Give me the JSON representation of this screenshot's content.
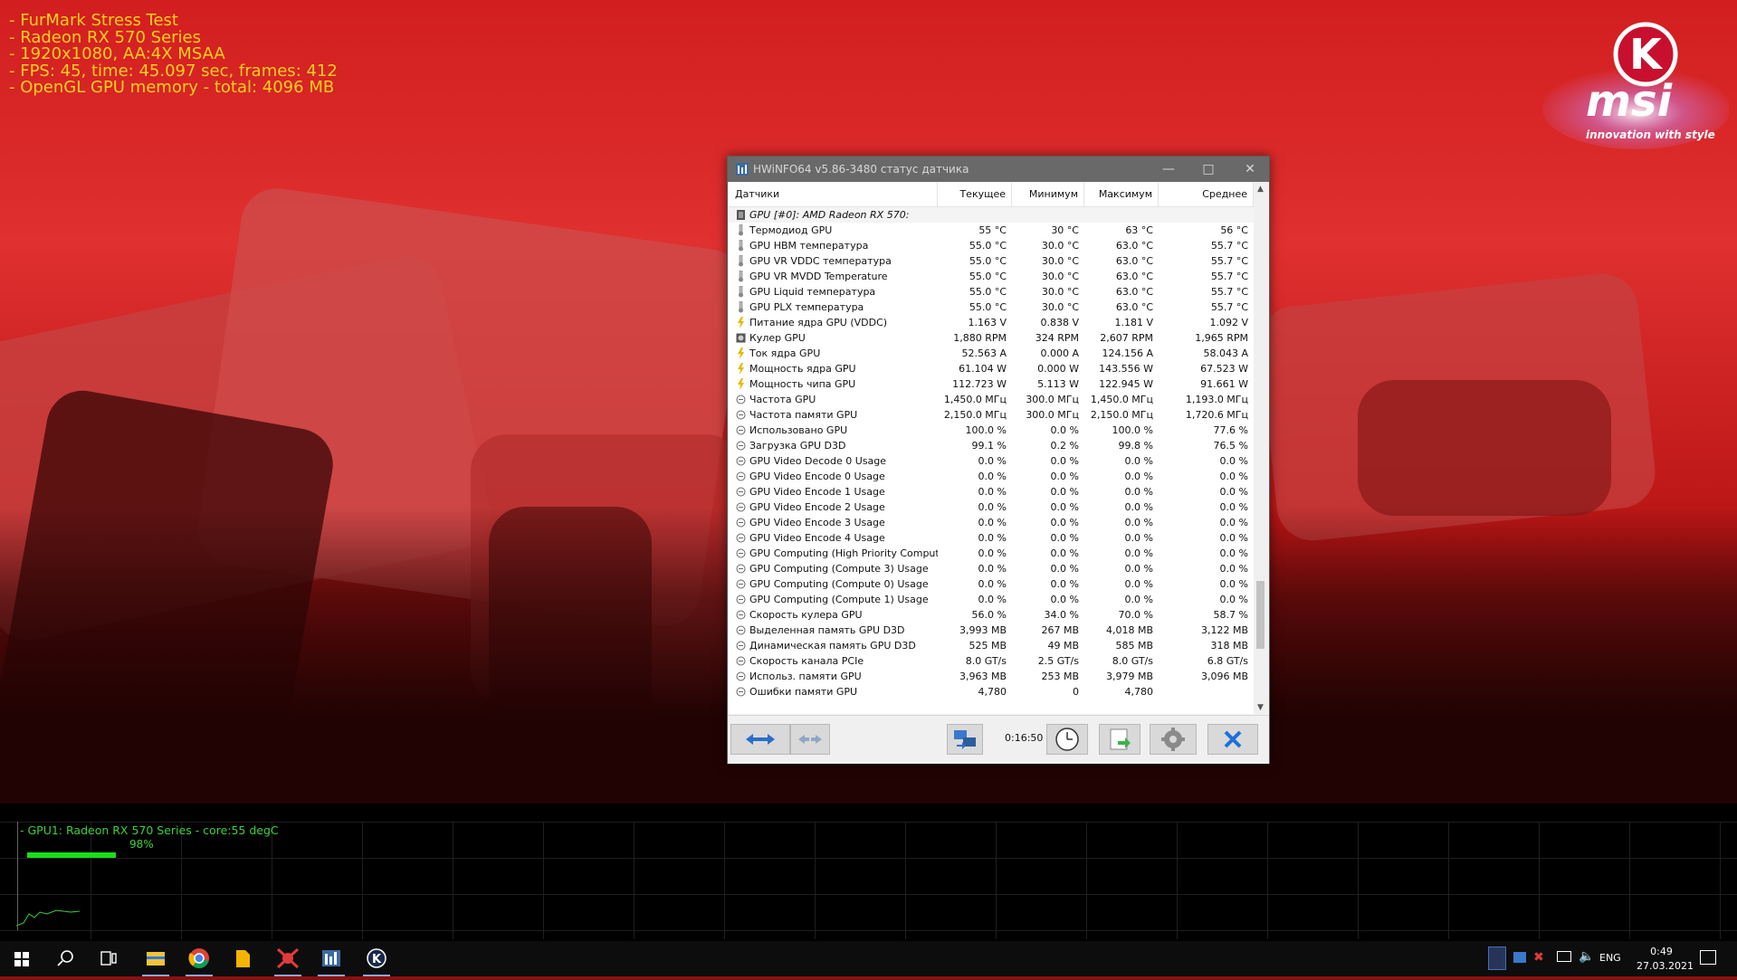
{
  "furmark": {
    "lines": [
      "- FurMark Stress Test",
      "- Radeon RX 570 Series",
      "- 1920x1080, AA:4X MSAA",
      "- FPS: 45, time: 45.097 sec, frames: 412",
      "- OpenGL GPU memory - total: 4096 MB"
    ],
    "graph_label": "- GPU1: Radeon RX 570 Series - core:55 degC",
    "graph_percent": "98%",
    "graph_bar_fraction": 0.98
  },
  "msi_logo": {
    "letter": "K",
    "brand": "msi",
    "tagline": "innovation with style"
  },
  "hwinfo": {
    "title": "HWiNFO64 v5.86-3480 статус датчика",
    "columns": [
      "Датчики",
      "Текущее",
      "Минимум",
      "Максимум",
      "Среднее"
    ],
    "group": "GPU [#0]: AMD Radeon RX 570:",
    "rows": [
      {
        "icon": "thermometer-icon",
        "name": "Термодиод GPU",
        "cur": "55 °C",
        "min": "30 °C",
        "max": "63 °C",
        "avg": "56 °C"
      },
      {
        "icon": "thermometer-icon",
        "name": "GPU HBM температура",
        "cur": "55.0 °C",
        "min": "30.0 °C",
        "max": "63.0 °C",
        "avg": "55.7 °C"
      },
      {
        "icon": "thermometer-icon",
        "name": "GPU VR VDDC температура",
        "cur": "55.0 °C",
        "min": "30.0 °C",
        "max": "63.0 °C",
        "avg": "55.7 °C"
      },
      {
        "icon": "thermometer-icon",
        "name": "GPU VR MVDD Temperature",
        "cur": "55.0 °C",
        "min": "30.0 °C",
        "max": "63.0 °C",
        "avg": "55.7 °C"
      },
      {
        "icon": "thermometer-icon",
        "name": "GPU Liquid температура",
        "cur": "55.0 °C",
        "min": "30.0 °C",
        "max": "63.0 °C",
        "avg": "55.7 °C"
      },
      {
        "icon": "thermometer-icon",
        "name": "GPU PLX температура",
        "cur": "55.0 °C",
        "min": "30.0 °C",
        "max": "63.0 °C",
        "avg": "55.7 °C"
      },
      {
        "icon": "bolt-icon",
        "name": "Питание ядра GPU (VDDC)",
        "cur": "1.163 V",
        "min": "0.838 V",
        "max": "1.181 V",
        "avg": "1.092 V"
      },
      {
        "icon": "fan-icon",
        "name": "Кулер GPU",
        "cur": "1,880 RPM",
        "min": "324 RPM",
        "max": "2,607 RPM",
        "avg": "1,965 RPM"
      },
      {
        "icon": "bolt-icon",
        "name": "Ток ядра GPU",
        "cur": "52.563 A",
        "min": "0.000 A",
        "max": "124.156 A",
        "avg": "58.043 A"
      },
      {
        "icon": "bolt-icon",
        "name": "Мощность ядра GPU",
        "cur": "61.104 W",
        "min": "0.000 W",
        "max": "143.556 W",
        "avg": "67.523 W"
      },
      {
        "icon": "bolt-icon",
        "name": "Мощность чипа GPU",
        "cur": "112.723 W",
        "min": "5.113 W",
        "max": "122.945 W",
        "avg": "91.661 W"
      },
      {
        "icon": "clock-icon",
        "name": "Частота GPU",
        "cur": "1,450.0 МГц",
        "min": "300.0 МГц",
        "max": "1,450.0 МГц",
        "avg": "1,193.0 МГц"
      },
      {
        "icon": "clock-icon",
        "name": "Частота памяти GPU",
        "cur": "2,150.0 МГц",
        "min": "300.0 МГц",
        "max": "2,150.0 МГц",
        "avg": "1,720.6 МГц"
      },
      {
        "icon": "clock-icon",
        "name": "Использовано GPU",
        "cur": "100.0 %",
        "min": "0.0 %",
        "max": "100.0 %",
        "avg": "77.6 %"
      },
      {
        "icon": "clock-icon",
        "name": "Загрузка GPU D3D",
        "cur": "99.1 %",
        "min": "0.2 %",
        "max": "99.8 %",
        "avg": "76.5 %"
      },
      {
        "icon": "clock-icon",
        "name": "GPU Video Decode 0 Usage",
        "cur": "0.0 %",
        "min": "0.0 %",
        "max": "0.0 %",
        "avg": "0.0 %"
      },
      {
        "icon": "clock-icon",
        "name": "GPU Video Encode 0 Usage",
        "cur": "0.0 %",
        "min": "0.0 %",
        "max": "0.0 %",
        "avg": "0.0 %"
      },
      {
        "icon": "clock-icon",
        "name": "GPU Video Encode 1 Usage",
        "cur": "0.0 %",
        "min": "0.0 %",
        "max": "0.0 %",
        "avg": "0.0 %"
      },
      {
        "icon": "clock-icon",
        "name": "GPU Video Encode 2 Usage",
        "cur": "0.0 %",
        "min": "0.0 %",
        "max": "0.0 %",
        "avg": "0.0 %"
      },
      {
        "icon": "clock-icon",
        "name": "GPU Video Encode 3 Usage",
        "cur": "0.0 %",
        "min": "0.0 %",
        "max": "0.0 %",
        "avg": "0.0 %"
      },
      {
        "icon": "clock-icon",
        "name": "GPU Video Encode 4 Usage",
        "cur": "0.0 %",
        "min": "0.0 %",
        "max": "0.0 %",
        "avg": "0.0 %"
      },
      {
        "icon": "clock-icon",
        "name": "GPU Computing (High Priority Compute) ...",
        "cur": "0.0 %",
        "min": "0.0 %",
        "max": "0.0 %",
        "avg": "0.0 %"
      },
      {
        "icon": "clock-icon",
        "name": "GPU Computing (Compute 3) Usage",
        "cur": "0.0 %",
        "min": "0.0 %",
        "max": "0.0 %",
        "avg": "0.0 %"
      },
      {
        "icon": "clock-icon",
        "name": "GPU Computing (Compute 0) Usage",
        "cur": "0.0 %",
        "min": "0.0 %",
        "max": "0.0 %",
        "avg": "0.0 %"
      },
      {
        "icon": "clock-icon",
        "name": "GPU Computing (Compute 1) Usage",
        "cur": "0.0 %",
        "min": "0.0 %",
        "max": "0.0 %",
        "avg": "0.0 %"
      },
      {
        "icon": "clock-icon",
        "name": "Скорость кулера GPU",
        "cur": "56.0 %",
        "min": "34.0 %",
        "max": "70.0 %",
        "avg": "58.7 %"
      },
      {
        "icon": "clock-icon",
        "name": "Выделенная память GPU D3D",
        "cur": "3,993 MB",
        "min": "267 MB",
        "max": "4,018 MB",
        "avg": "3,122 MB"
      },
      {
        "icon": "clock-icon",
        "name": "Динамическая память GPU D3D",
        "cur": "525 MB",
        "min": "49 MB",
        "max": "585 MB",
        "avg": "318 MB"
      },
      {
        "icon": "clock-icon",
        "name": "Скорость канала PCIe",
        "cur": "8.0 GT/s",
        "min": "2.5 GT/s",
        "max": "8.0 GT/s",
        "avg": "6.8 GT/s"
      },
      {
        "icon": "clock-icon",
        "name": "Использ. памяти GPU",
        "cur": "3,963 MB",
        "min": "253 MB",
        "max": "3,979 MB",
        "avg": "3,096 MB"
      },
      {
        "icon": "clock-icon",
        "name": "Ошибки памяти GPU",
        "cur": "4,780",
        "min": "0",
        "max": "4,780",
        "avg": ""
      }
    ],
    "elapsed": "0:16:50"
  },
  "taskbar": {
    "apps": [
      "start-icon",
      "search-icon",
      "task-view-icon",
      "file-explorer-icon",
      "chrome-icon",
      "files-icon",
      "furmark-icon",
      "hwinfo-icon",
      "msi-kombustor-icon"
    ],
    "lang": "ENG",
    "time": "0:49",
    "date": "27.03.2021"
  },
  "colors": {
    "overlay_text": "#ffcf1f",
    "graph_green": "#3cd03c",
    "title_bar": "#696969",
    "close_button_blue": "#1e6fd9"
  }
}
